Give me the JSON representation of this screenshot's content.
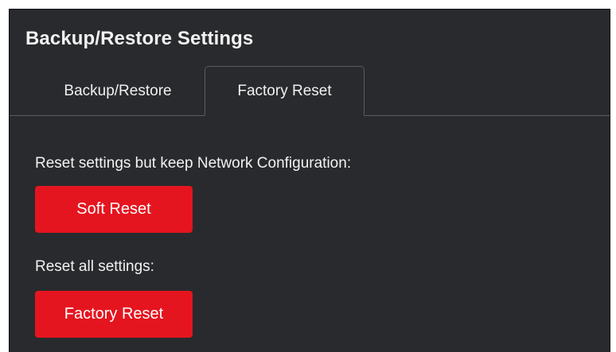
{
  "panel": {
    "title": "Backup/Restore Settings"
  },
  "tabs": [
    {
      "label": "Backup/Restore",
      "active": false
    },
    {
      "label": "Factory Reset",
      "active": true
    }
  ],
  "factory_reset": {
    "soft_label": "Reset settings but keep Network Configuration:",
    "soft_button": "Soft Reset",
    "all_label": "Reset all settings:",
    "factory_button": "Factory Reset"
  },
  "colors": {
    "panel_background": "#292a2d",
    "danger_button": "#e5151f",
    "text": "#f2f2f2"
  }
}
